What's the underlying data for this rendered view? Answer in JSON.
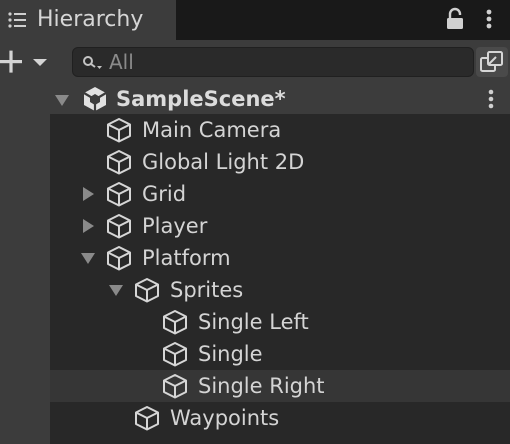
{
  "panel": {
    "title": "Hierarchy",
    "icons": {
      "tab": "list-icon",
      "lock": "lock-icon",
      "menu": "kebab-menu-icon"
    }
  },
  "toolbar": {
    "add_icon": "plus-dropdown-icon",
    "search": {
      "placeholder": "All",
      "value": ""
    },
    "scene_visibility_icon": "scene-visibility-icon"
  },
  "scene": {
    "name": "SampleScene*",
    "expanded": true,
    "icon": "unity-logo-icon"
  },
  "items": [
    {
      "label": "Main Camera",
      "depth": 1,
      "expander": "none",
      "selected": false
    },
    {
      "label": "Global Light 2D",
      "depth": 1,
      "expander": "none",
      "selected": false
    },
    {
      "label": "Grid",
      "depth": 1,
      "expander": "collapsed",
      "selected": false
    },
    {
      "label": "Player",
      "depth": 1,
      "expander": "collapsed",
      "selected": false
    },
    {
      "label": "Platform",
      "depth": 1,
      "expander": "expanded",
      "selected": false
    },
    {
      "label": "Sprites",
      "depth": 2,
      "expander": "expanded",
      "selected": false
    },
    {
      "label": "Single Left",
      "depth": 3,
      "expander": "none",
      "selected": false
    },
    {
      "label": "Single",
      "depth": 3,
      "expander": "none",
      "selected": false
    },
    {
      "label": "Single Right",
      "depth": 3,
      "expander": "none",
      "selected": true
    },
    {
      "label": "Waypoints",
      "depth": 2,
      "expander": "none",
      "selected": false
    }
  ],
  "colors": {
    "background": "#282828",
    "header": "#3c3c3c",
    "selected_row": "#363636",
    "text": "#d4d4d4"
  }
}
